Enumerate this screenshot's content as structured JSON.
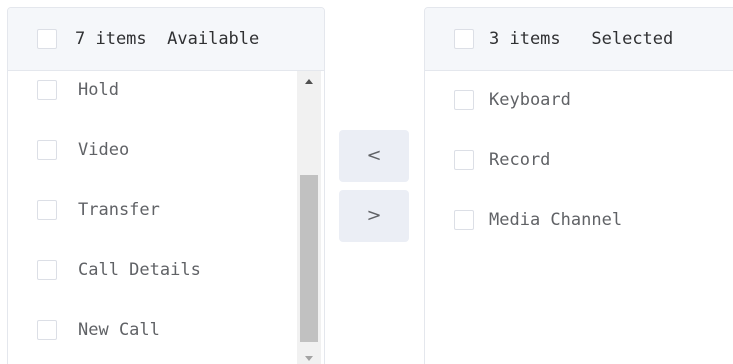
{
  "left_panel": {
    "header_count": "7 items",
    "header_title": "Available",
    "items": [
      {
        "label": "Hold"
      },
      {
        "label": "Video"
      },
      {
        "label": "Transfer"
      },
      {
        "label": "Call Details"
      },
      {
        "label": "New Call"
      }
    ]
  },
  "right_panel": {
    "header_count": "3 items",
    "header_title": "Selected",
    "items": [
      {
        "label": "Keyboard"
      },
      {
        "label": "Record"
      },
      {
        "label": "Media Channel"
      }
    ]
  },
  "buttons": {
    "move_left": "<",
    "move_right": ">"
  },
  "colors": {
    "border": "#e4e7ed",
    "header_bg": "#f5f7fa",
    "button_bg": "#ebeef5",
    "scroll_thumb": "#c1c1c1"
  }
}
